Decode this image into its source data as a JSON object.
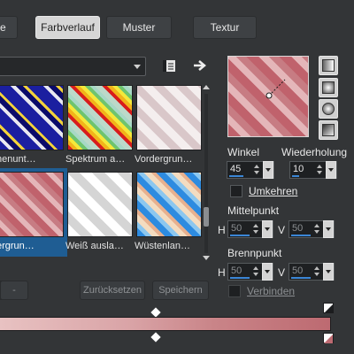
{
  "tabs": [
    {
      "label": "be",
      "active": false
    },
    {
      "label": "Farbverlauf",
      "active": true
    },
    {
      "label": "Muster",
      "active": false
    },
    {
      "label": "Textur",
      "active": false
    }
  ],
  "toolbar": {
    "dropdown_value": "",
    "list_icon": "list-icon",
    "arrow_icon": "arrow-right-icon"
  },
  "presets": [
    {
      "label": "henunt…",
      "selected": false
    },
    {
      "label": "Spektrum a…",
      "selected": false
    },
    {
      "label": "Vordergrun…",
      "selected": false
    },
    {
      "label": "ergrun…",
      "selected": true
    },
    {
      "label": "Weiß auslа…",
      "selected": false
    },
    {
      "label": "Wüstenlan…",
      "selected": false
    }
  ],
  "settings": {
    "winkel_label": "Winkel",
    "winkel_value": "45",
    "wiederholung_label": "Wiederholung",
    "wiederholung_value": "10",
    "umkehren_label": "Umkehren",
    "mittelpunkt_label": "Mittelpunkt",
    "mittel_h_label": "H",
    "mittel_h_value": "50",
    "mittel_v_label": "V",
    "mittel_v_value": "50",
    "brennpunkt_label": "Brennpunkt",
    "brenn_h_label": "H",
    "brenn_h_value": "50",
    "brenn_v_label": "V",
    "brenn_v_value": "50",
    "verbinden_label": "Verbinden"
  },
  "buttons": {
    "minus_label": "-",
    "reset_label": "Zurücksetzen",
    "save_label": "Speichern"
  },
  "colors": {
    "accent": "#3b86d6",
    "selection": "#1f5d93",
    "gradient_start": "#e8c2c2",
    "gradient_end": "#bd6a71"
  }
}
